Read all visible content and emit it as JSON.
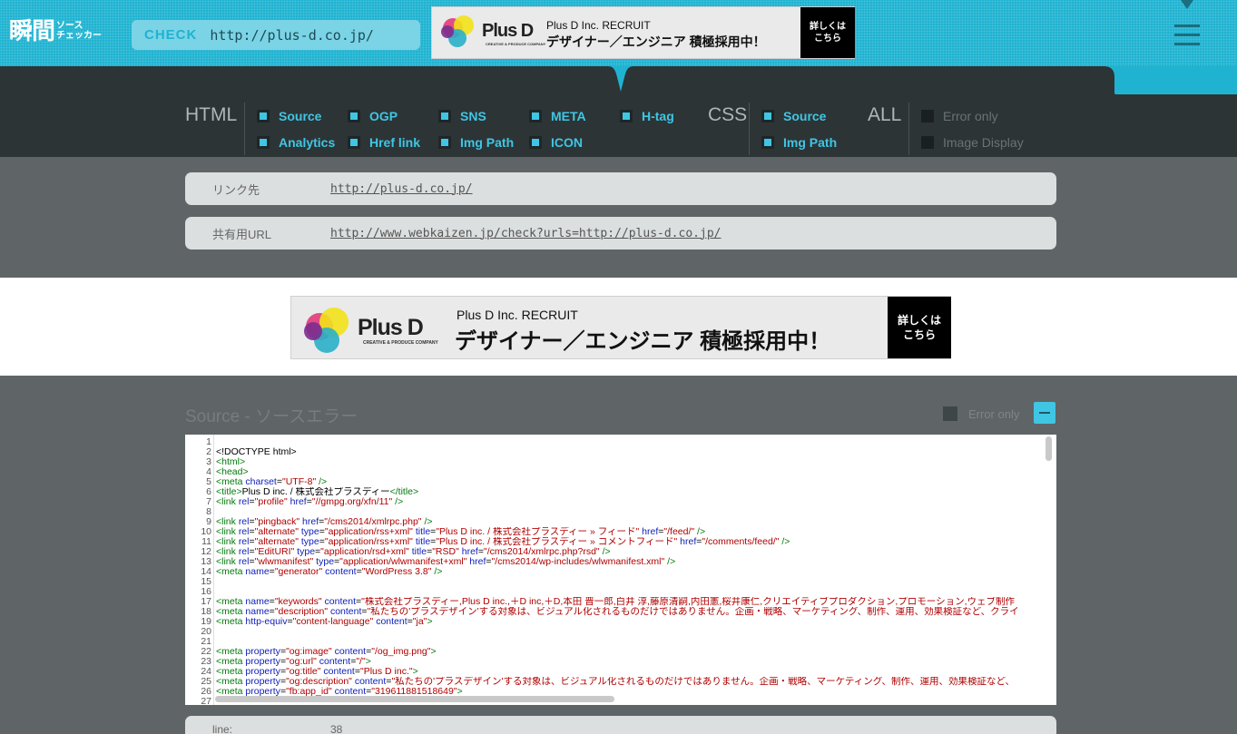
{
  "header": {
    "logo_main": "瞬間",
    "logo_sub_1": "ソース",
    "logo_sub_2": "チェッカー",
    "check_label": "CHECK",
    "check_value": "http://plus-d.co.jp/"
  },
  "banner": {
    "brand": "Plus D",
    "brand_sub": "CREATIVE & PRODUCE COMPANY",
    "title": "Plus D Inc. RECRUIT",
    "headline": "デザイナー／エンジニア 積極採用中！",
    "cta_line1": "詳しくは",
    "cta_line2": "こちら"
  },
  "nav": {
    "html_title": "HTML",
    "css_title": "CSS",
    "all_title": "ALL",
    "html_options": [
      {
        "label": "Source"
      },
      {
        "label": "OGP"
      },
      {
        "label": "SNS"
      },
      {
        "label": "META"
      },
      {
        "label": "H-tag"
      },
      {
        "label": "Analytics"
      },
      {
        "label": "Href link"
      },
      {
        "label": "Img Path"
      },
      {
        "label": "ICON"
      }
    ],
    "css_options": [
      {
        "label": "Source"
      },
      {
        "label": "Img Path"
      }
    ],
    "all_options": [
      {
        "label": "Error only"
      },
      {
        "label": "Image Display"
      }
    ]
  },
  "info": {
    "link_label": "リンク先",
    "link_value": "http://plus-d.co.jp/",
    "share_label": "共有用URL",
    "share_value": "http://www.webkaizen.jp/check?urls=http://plus-d.co.jp/"
  },
  "source_section": {
    "title": "Source - ソースエラー",
    "error_only": "Error only"
  },
  "code_lines": [
    [],
    [
      [
        "t",
        "<!DOCTYPE html>"
      ]
    ],
    [
      [
        "g",
        "<html>"
      ]
    ],
    [
      [
        "g",
        "<head>"
      ]
    ],
    [
      [
        "g",
        "<meta "
      ],
      [
        "a",
        "charset"
      ],
      [
        "t",
        "="
      ],
      [
        "v",
        "\"UTF-8\""
      ],
      [
        "g",
        " />"
      ]
    ],
    [
      [
        "g",
        "<title>"
      ],
      [
        "t",
        "Plus D inc. / 株式会社プラスディー"
      ],
      [
        "g",
        "</title>"
      ]
    ],
    [
      [
        "g",
        "<link "
      ],
      [
        "a",
        "rel"
      ],
      [
        "t",
        "="
      ],
      [
        "v",
        "\"profile\""
      ],
      [
        "a",
        " href"
      ],
      [
        "t",
        "="
      ],
      [
        "v",
        "\"//gmpg.org/xfn/11\""
      ],
      [
        "g",
        " />"
      ]
    ],
    [],
    [
      [
        "g",
        "<link "
      ],
      [
        "a",
        "rel"
      ],
      [
        "t",
        "="
      ],
      [
        "v",
        "\"pingback\""
      ],
      [
        "a",
        " href"
      ],
      [
        "t",
        "="
      ],
      [
        "v",
        "\"/cms2014/xmlrpc.php\""
      ],
      [
        "g",
        " />"
      ]
    ],
    [
      [
        "g",
        "<link "
      ],
      [
        "a",
        "rel"
      ],
      [
        "t",
        "="
      ],
      [
        "v",
        "\"alternate\""
      ],
      [
        "a",
        " type"
      ],
      [
        "t",
        "="
      ],
      [
        "v",
        "\"application/rss+xml\""
      ],
      [
        "a",
        " title"
      ],
      [
        "t",
        "="
      ],
      [
        "v",
        "\"Plus D inc. / 株式会社プラスディー » フィード\""
      ],
      [
        "a",
        " href"
      ],
      [
        "t",
        "="
      ],
      [
        "v",
        "\"/feed/\""
      ],
      [
        "g",
        " />"
      ]
    ],
    [
      [
        "g",
        "<link "
      ],
      [
        "a",
        "rel"
      ],
      [
        "t",
        "="
      ],
      [
        "v",
        "\"alternate\""
      ],
      [
        "a",
        " type"
      ],
      [
        "t",
        "="
      ],
      [
        "v",
        "\"application/rss+xml\""
      ],
      [
        "a",
        " title"
      ],
      [
        "t",
        "="
      ],
      [
        "v",
        "\"Plus D inc. / 株式会社プラスディー » コメントフィード\""
      ],
      [
        "a",
        " href"
      ],
      [
        "t",
        "="
      ],
      [
        "v",
        "\"/comments/feed/\""
      ],
      [
        "g",
        " />"
      ]
    ],
    [
      [
        "g",
        "<link "
      ],
      [
        "a",
        "rel"
      ],
      [
        "t",
        "="
      ],
      [
        "v",
        "\"EditURI\""
      ],
      [
        "a",
        " type"
      ],
      [
        "t",
        "="
      ],
      [
        "v",
        "\"application/rsd+xml\""
      ],
      [
        "a",
        " title"
      ],
      [
        "t",
        "="
      ],
      [
        "v",
        "\"RSD\""
      ],
      [
        "a",
        " href"
      ],
      [
        "t",
        "="
      ],
      [
        "v",
        "\"/cms2014/xmlrpc.php?rsd\""
      ],
      [
        "g",
        " />"
      ]
    ],
    [
      [
        "g",
        "<link "
      ],
      [
        "a",
        "rel"
      ],
      [
        "t",
        "="
      ],
      [
        "v",
        "\"wlwmanifest\""
      ],
      [
        "a",
        " type"
      ],
      [
        "t",
        "="
      ],
      [
        "v",
        "\"application/wlwmanifest+xml\""
      ],
      [
        "a",
        " href"
      ],
      [
        "t",
        "="
      ],
      [
        "v",
        "\"/cms2014/wp-includes/wlwmanifest.xml\""
      ],
      [
        "g",
        " />"
      ]
    ],
    [
      [
        "g",
        "<meta "
      ],
      [
        "a",
        "name"
      ],
      [
        "t",
        "="
      ],
      [
        "v",
        "\"generator\""
      ],
      [
        "a",
        " content"
      ],
      [
        "t",
        "="
      ],
      [
        "v",
        "\"WordPress 3.8\""
      ],
      [
        "g",
        " />"
      ]
    ],
    [],
    [],
    [
      [
        "g",
        "<meta "
      ],
      [
        "a",
        "name"
      ],
      [
        "t",
        "="
      ],
      [
        "v",
        "\"keywords\""
      ],
      [
        "a",
        " content"
      ],
      [
        "t",
        "="
      ],
      [
        "v",
        "\"株式会社プラスディー,Plus D inc.,＋D inc,＋D,本田 晋一郎,白井 淳,藤原清嗣,内田憲,桜井康仁,クリエイティブプロダクション,プロモーション,ウェブ制作"
      ]
    ],
    [
      [
        "g",
        "<meta "
      ],
      [
        "a",
        "name"
      ],
      [
        "t",
        "="
      ],
      [
        "v",
        "\"description\""
      ],
      [
        "a",
        " content"
      ],
      [
        "t",
        "="
      ],
      [
        "v",
        "\"私たちの'プラスデザイン'する対象は、ビジュアル化されるものだけではありません。企画・戦略、マーケティング、制作、運用、効果検証など、クライ"
      ]
    ],
    [
      [
        "g",
        "<meta "
      ],
      [
        "a",
        "http-equiv"
      ],
      [
        "t",
        "="
      ],
      [
        "v",
        "\"content-language\""
      ],
      [
        "a",
        " content"
      ],
      [
        "t",
        "="
      ],
      [
        "v",
        "\"ja\""
      ],
      [
        "g",
        ">"
      ]
    ],
    [],
    [],
    [
      [
        "g",
        "<meta "
      ],
      [
        "a",
        "property"
      ],
      [
        "t",
        "="
      ],
      [
        "v",
        "\"og:image\""
      ],
      [
        "a",
        " content"
      ],
      [
        "t",
        "="
      ],
      [
        "v",
        "\"/og_img.png\""
      ],
      [
        "g",
        ">"
      ]
    ],
    [
      [
        "g",
        "<meta "
      ],
      [
        "a",
        "property"
      ],
      [
        "t",
        "="
      ],
      [
        "v",
        "\"og:url\""
      ],
      [
        "a",
        " content"
      ],
      [
        "t",
        "="
      ],
      [
        "v",
        "\"/\""
      ],
      [
        "g",
        ">"
      ]
    ],
    [
      [
        "g",
        "<meta "
      ],
      [
        "a",
        "property"
      ],
      [
        "t",
        "="
      ],
      [
        "v",
        "\"og:title\""
      ],
      [
        "a",
        " content"
      ],
      [
        "t",
        "="
      ],
      [
        "v",
        "\"Plus D inc.\""
      ],
      [
        "g",
        ">"
      ]
    ],
    [
      [
        "g",
        "<meta "
      ],
      [
        "a",
        "property"
      ],
      [
        "t",
        "="
      ],
      [
        "v",
        "\"og:description\""
      ],
      [
        "a",
        " content"
      ],
      [
        "t",
        "="
      ],
      [
        "v",
        "\"私たちの'プラスデザイン'する対象は、ビジュアル化されるものだけではありません。企画・戦略、マーケティング、制作、運用、効果検証など、"
      ]
    ],
    [
      [
        "g",
        "<meta "
      ],
      [
        "a",
        "property"
      ],
      [
        "t",
        "="
      ],
      [
        "v",
        "\"fb:app_id\""
      ],
      [
        "a",
        " content"
      ],
      [
        "t",
        "="
      ],
      [
        "v",
        "\"319611881518649\""
      ],
      [
        "g",
        ">"
      ]
    ],
    []
  ],
  "bottom": {
    "line_label": "line:",
    "line_value": "38"
  },
  "colors": {
    "accent": "#1fb3d1",
    "checkbox_on": "#3fc6e4",
    "nav_bg": "#2d3436",
    "page_bg": "#5f6566"
  }
}
